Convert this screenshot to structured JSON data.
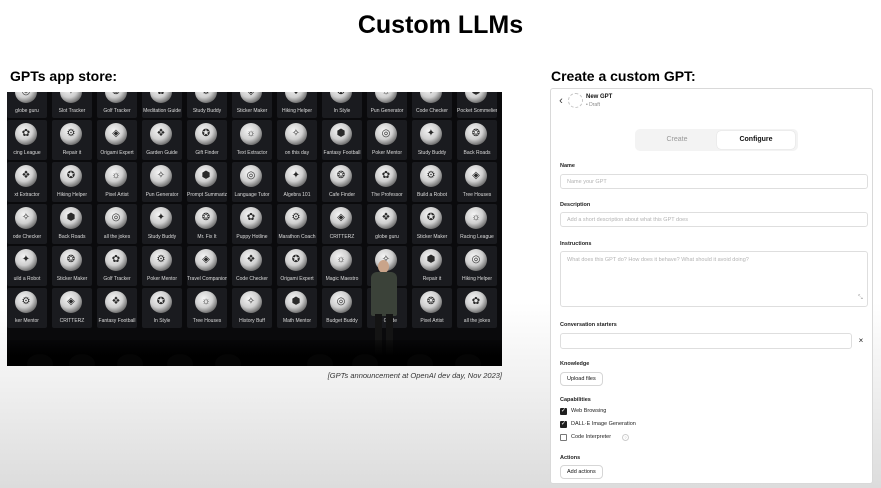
{
  "slide": {
    "title": "Custom LLMs",
    "left_heading": "GPTs app store:",
    "right_heading": "Create a custom GPT:",
    "caption": "[GPTs announcement at OpenAI dev day, Nov 2023]"
  },
  "app_wall": {
    "rows": [
      [
        "globe guru",
        "Slot Tracker",
        "Golf Tracker",
        "Meditation Guide",
        "Study Buddy",
        "Sticker Maker",
        "Hiking Helper",
        "In Style",
        "Pun Generator",
        "Code Checker",
        "Pocket Sommelier"
      ],
      [
        "cing League",
        "Repair it",
        "Origami Expert",
        "Garden Guide",
        "Gift Finder",
        "Text Extractor",
        "on this day",
        "Fantasy Football",
        "Poker Mentor",
        "Study Buddy",
        "Back Roads"
      ],
      [
        "xt Extractor",
        "Hiking Helper",
        "Pixel Artist",
        "Pun Generator",
        "Prompt Summarizer",
        "Language Tutor",
        "Algebra 101",
        "Cafe Finder",
        "The Professor",
        "Build a Robot",
        "Tree Houses"
      ],
      [
        "ode Checker",
        "Back Roads",
        "all the jokes",
        "Study Buddy",
        "Mr. Fix It",
        "Puppy Hotline",
        "Marathon Coach",
        "CRITTERZ",
        "globe guru",
        "Sticker Maker",
        "Racing League"
      ],
      [
        "uild a Robot",
        "Sticker Maker",
        "Golf Tracker",
        "Poker Mentor",
        "Travel Companion",
        "Code Checker",
        "Origami Expert",
        "Magic Maestro",
        "",
        "Repair it",
        "Hiking Helper"
      ],
      [
        "ker Mentor",
        "CRITTERZ",
        "Fantasy Football",
        "In Style",
        "Tree Houses",
        "History Buff",
        "Math Mentor",
        "Budget Buddy",
        "ve Guide",
        "Pixel Artist",
        "all the jokes"
      ]
    ]
  },
  "builder": {
    "gpt_name": "New GPT",
    "gpt_status": "• Draft",
    "tabs": {
      "create": "Create",
      "configure": "Configure"
    },
    "name_label": "Name",
    "name_placeholder": "Name your GPT",
    "description_label": "Description",
    "description_placeholder": "Add a short description about what this GPT does",
    "instructions_label": "Instructions",
    "instructions_placeholder": "What does this GPT do? How does it behave? What should it avoid doing?",
    "starters_label": "Conversation starters",
    "starters_value": "",
    "clear_glyph": "×",
    "knowledge_label": "Knowledge",
    "upload_button": "Upload files",
    "capabilities_label": "Capabilities",
    "capabilities": [
      {
        "label": "Web Browsing",
        "checked": true
      },
      {
        "label": "DALL·E Image Generation",
        "checked": true
      },
      {
        "label": "Code Interpreter",
        "checked": false
      }
    ],
    "actions_label": "Actions",
    "add_actions_button": "Add actions",
    "back_icon": "chevron-left-icon",
    "info_glyph": "?"
  }
}
